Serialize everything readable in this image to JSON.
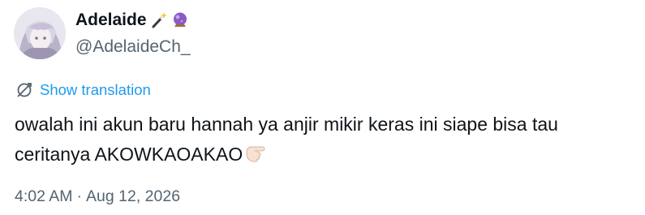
{
  "author": {
    "display_name": "Adelaide",
    "handle": "@AdelaideCh_",
    "name_emojis": [
      "magic-wand-emoji",
      "crystal-ball-emoji"
    ]
  },
  "translate": {
    "label": "Show translation",
    "icon": "translate-icon"
  },
  "tweet": {
    "line1": "owalah ini akun baru hannah ya anjir mikir keras ini siape bisa tau",
    "line2": "ceritanya AKOWKAOAKAO",
    "trailing_emoji": "pointing-hand-emoji"
  },
  "meta": {
    "time": "4:02 AM",
    "separator": "·",
    "date": "Aug 12, 2026"
  },
  "colors": {
    "link": "#1d9bf0",
    "secondary": "#536471",
    "primary": "#0f1419"
  }
}
